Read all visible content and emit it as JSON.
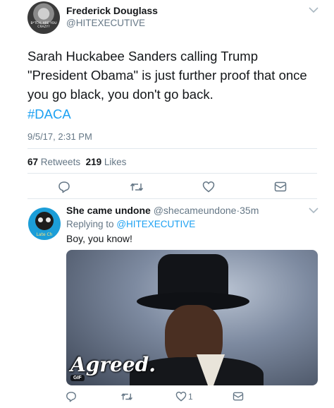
{
  "main_tweet": {
    "avatar_caption": "B*TCH, ARE YOU CRAZY?",
    "author_name": "Frederick Douglass",
    "author_handle": "@HITEXECUTIVE",
    "text": "Sarah Huckabee Sanders calling Trump \"President Obama\" is just further proof that once you go black, you don't go back.",
    "hashtag": "#DACA",
    "timestamp": "9/5/17, 2:31 PM",
    "retweets_count": "67",
    "retweets_label": "Retweets",
    "likes_count": "219",
    "likes_label": "Likes",
    "actions": [
      "reply-icon",
      "retweet-icon",
      "like-icon",
      "dm-icon"
    ]
  },
  "reply_tweet": {
    "avatar_caption": "Late Ch",
    "author_name": "She came undone",
    "author_handle": "@shecameundone",
    "separator": "·",
    "time": "35m",
    "replying_prefix": "Replying to",
    "replying_to": "@HITEXECUTIVE",
    "text": "Boy, you know!",
    "gif_caption": "Agreed.",
    "gif_badge": "GIF",
    "like_count": "1",
    "actions": [
      "reply-icon",
      "retweet-icon",
      "like-icon",
      "dm-icon"
    ]
  },
  "colors": {
    "accent": "#1da1f2",
    "secondary_text": "#657786",
    "primary_text": "#14171a",
    "divider": "#e1e8ed"
  }
}
